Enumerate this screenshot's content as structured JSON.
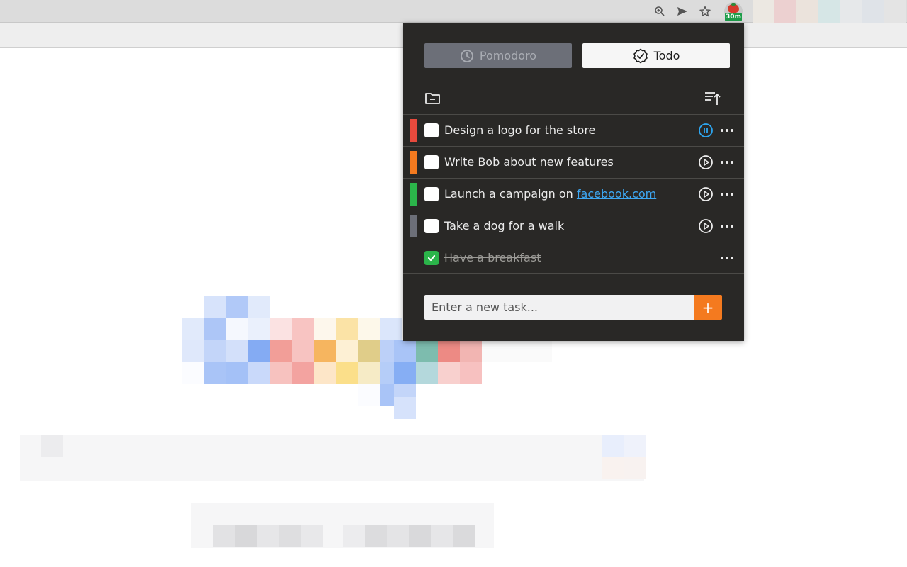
{
  "browser": {
    "icons": [
      "zoom-icon",
      "send-icon",
      "star-icon"
    ],
    "extension": {
      "icon": "tomato-icon",
      "badge": "30m"
    }
  },
  "popup": {
    "modes": [
      {
        "label": "Pomodoro",
        "icon": "clock-icon",
        "active": false
      },
      {
        "label": "Todo",
        "icon": "check-badge-icon",
        "active": true
      }
    ],
    "actions": {
      "left": "folder-minus-icon",
      "right": "sort-icon"
    },
    "tasks": [
      {
        "text": "Design a logo for the store",
        "color": "#e84a3d",
        "done": false,
        "state": "paused"
      },
      {
        "text": "Write Bob about new features",
        "color": "#f47a1f",
        "done": false,
        "state": "play"
      },
      {
        "text": "Launch a campaign on ",
        "link": "facebook.com",
        "color": "#2bb44a",
        "done": false,
        "state": "play"
      },
      {
        "text": "Take a dog for a walk",
        "color": "#6c6f78",
        "done": false,
        "state": "play"
      },
      {
        "text": "Have a breakfast",
        "done": true
      }
    ],
    "new_task": {
      "placeholder": "Enter a new task...",
      "add_label": "+"
    }
  },
  "colors": {
    "popup_bg": "#292826",
    "accent": "#f47a1f",
    "active_task_icon": "#2da7f2"
  }
}
